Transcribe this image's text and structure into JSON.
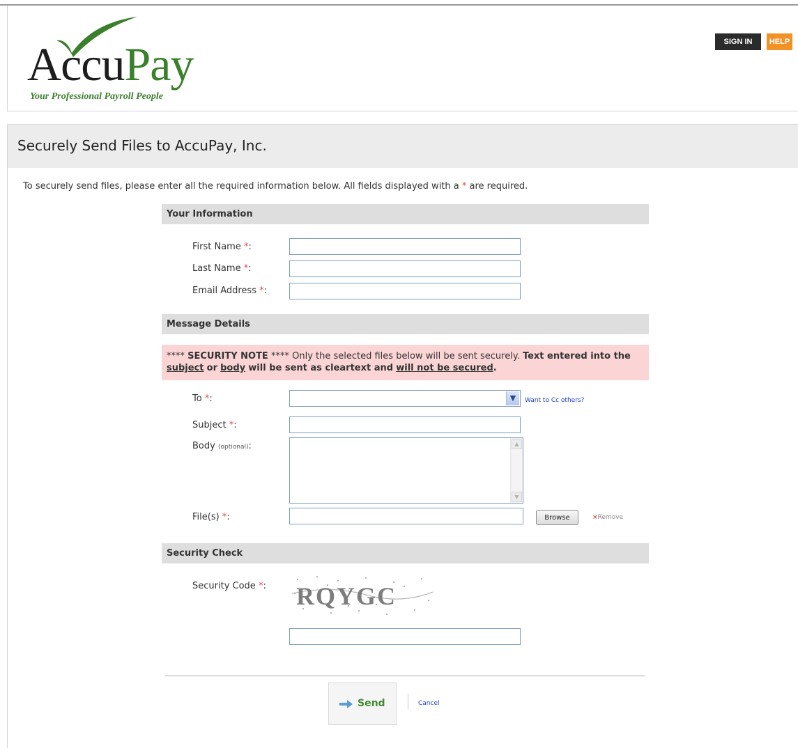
{
  "header": {
    "logo_text_left": "Accu",
    "logo_text_right": "Pay",
    "logo_tagline": "Your Professional Payroll People",
    "sign_in_label": "SIGN IN",
    "help_label": "HELP"
  },
  "page": {
    "title": "Securely Send Files to AccuPay, Inc.",
    "intro_before": "To securely send files, please enter all the required information below. All fields displayed with a",
    "intro_star": "*",
    "intro_after": "are required."
  },
  "sections": {
    "your_information": "Your Information",
    "message_details": "Message Details",
    "security_check": "Security Check"
  },
  "form": {
    "required_marker": "*",
    "first_name_label": "First Name",
    "last_name_label": "Last Name",
    "email_label": "Email Address",
    "to_label": "To",
    "subject_label": "Subject",
    "body_label": "Body",
    "body_optional": "(optional)",
    "files_label": "File(s)",
    "security_code_label": "Security Code",
    "colon": ":",
    "first_name_value": "",
    "last_name_value": "",
    "email_value": "",
    "subject_value": "",
    "security_code_value": "",
    "to_selected": "",
    "cc_link": "Want to Cc others?",
    "browse_label": "Browse",
    "remove_x": "×",
    "remove_label": "Remove"
  },
  "security_note": {
    "prefix_stars": "****",
    "title": "SECURITY NOTE",
    "suffix_stars": "****",
    "text1": "Only the selected files below will be sent securely.",
    "bold1": "Text entered into the",
    "subject_word": "subject",
    "or_word": "or",
    "body_word": "body",
    "bold2": "will be sent as cleartext and",
    "not_secured": "will not be secured",
    "period": "."
  },
  "captcha": {
    "text": "RQYGC"
  },
  "actions": {
    "send_label": "Send",
    "cancel_label": "Cancel"
  },
  "colors": {
    "brand_green": "#3a7f2a",
    "help_orange": "#f39224",
    "required_red": "#d9534f",
    "note_pink": "#fbd5d5",
    "link_blue": "#1e3dc8"
  }
}
